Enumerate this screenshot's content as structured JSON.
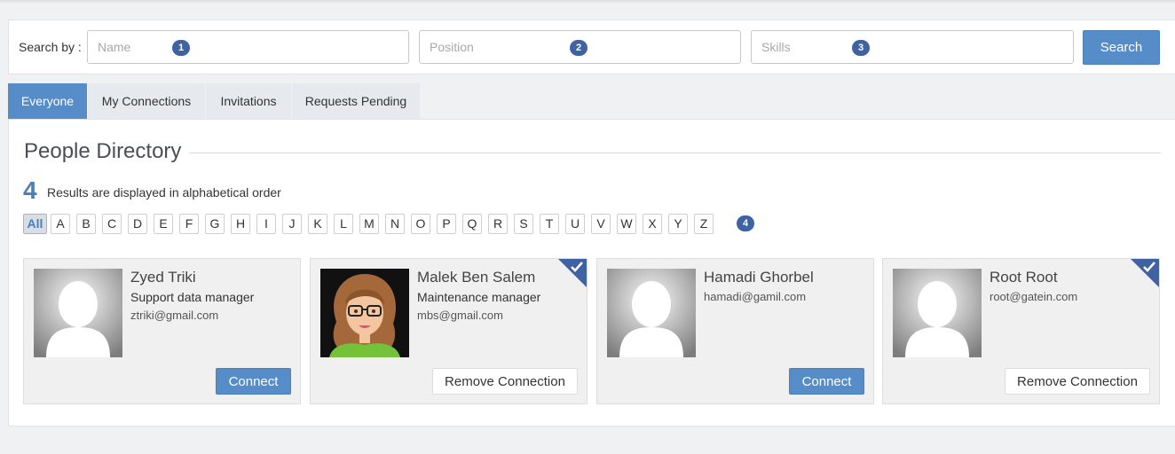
{
  "search": {
    "label": "Search by :",
    "name_placeholder": "Name",
    "position_placeholder": "Position",
    "skills_placeholder": "Skills",
    "badges": [
      "1",
      "2",
      "3"
    ],
    "button_label": "Search"
  },
  "tabs": [
    {
      "label": "Everyone",
      "active": true
    },
    {
      "label": "My Connections",
      "active": false
    },
    {
      "label": "Invitations",
      "active": false
    },
    {
      "label": "Requests Pending",
      "active": false
    }
  ],
  "directory": {
    "title": "People Directory",
    "result_count": "4",
    "result_text": "Results are displayed in alphabetical order",
    "letters": [
      "All",
      "A",
      "B",
      "C",
      "D",
      "E",
      "F",
      "G",
      "H",
      "I",
      "J",
      "K",
      "L",
      "M",
      "N",
      "O",
      "P",
      "Q",
      "R",
      "S",
      "T",
      "U",
      "V",
      "W",
      "X",
      "Y",
      "Z"
    ],
    "letters_badge": "4"
  },
  "people": [
    {
      "name": "Zyed Triki",
      "position": "Support data manager",
      "email": "ztriki@gmail.com",
      "action": "Connect",
      "connected": false,
      "avatar": "default-avatar-icon"
    },
    {
      "name": "Malek Ben Salem",
      "position": "Maintenance manager",
      "email": "mbs@gmail.com",
      "action": "Remove Connection",
      "connected": true,
      "avatar": "cartoon-woman-avatar"
    },
    {
      "name": "Hamadi Ghorbel",
      "position": "",
      "email": "hamadi@gamil.com",
      "action": "Connect",
      "connected": false,
      "avatar": "default-avatar-icon"
    },
    {
      "name": "Root Root",
      "position": "",
      "email": "root@gatein.com",
      "action": "Remove Connection",
      "connected": true,
      "avatar": "default-avatar-icon"
    }
  ],
  "colors": {
    "accent": "#568dc8",
    "badge": "#3f62a3",
    "count": "#4a7fb8"
  }
}
